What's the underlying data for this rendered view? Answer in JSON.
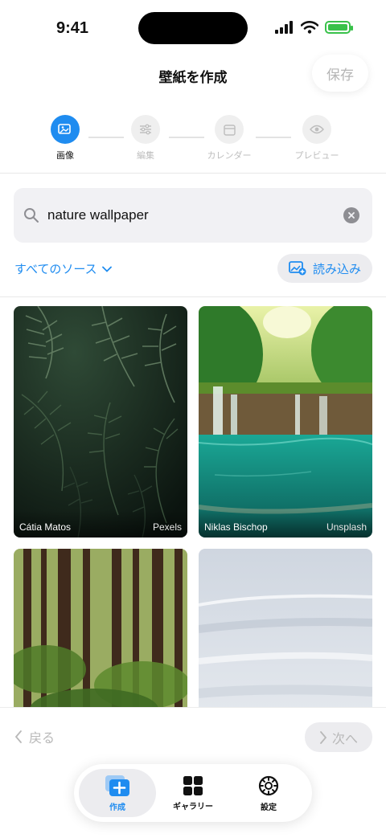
{
  "status": {
    "time": "9:41"
  },
  "header": {
    "title": "壁紙を作成",
    "save_label": "保存"
  },
  "steps": [
    {
      "label": "画像",
      "icon": "image-icon",
      "active": true
    },
    {
      "label": "編集",
      "icon": "sliders-icon",
      "active": false
    },
    {
      "label": "カレンダー",
      "icon": "calendar-icon",
      "active": false
    },
    {
      "label": "プレビュー",
      "icon": "eye-icon",
      "active": false
    }
  ],
  "search": {
    "query": "nature wallpaper"
  },
  "source_filter": {
    "label": "すべてのソース"
  },
  "import_button": {
    "label": "読み込み"
  },
  "results": [
    {
      "author": "Cátia Matos",
      "source": "Pexels"
    },
    {
      "author": "Niklas Bischop",
      "source": "Unsplash"
    },
    {
      "author": "",
      "source": ""
    },
    {
      "author": "",
      "source": ""
    }
  ],
  "nav": {
    "back_label": "戻る",
    "next_label": "次へ"
  },
  "tabbar": {
    "create_label": "作成",
    "gallery_label": "ギャラリー",
    "settings_label": "設定"
  },
  "colors": {
    "accent": "#1f8cf0",
    "battery": "#39c14a"
  }
}
